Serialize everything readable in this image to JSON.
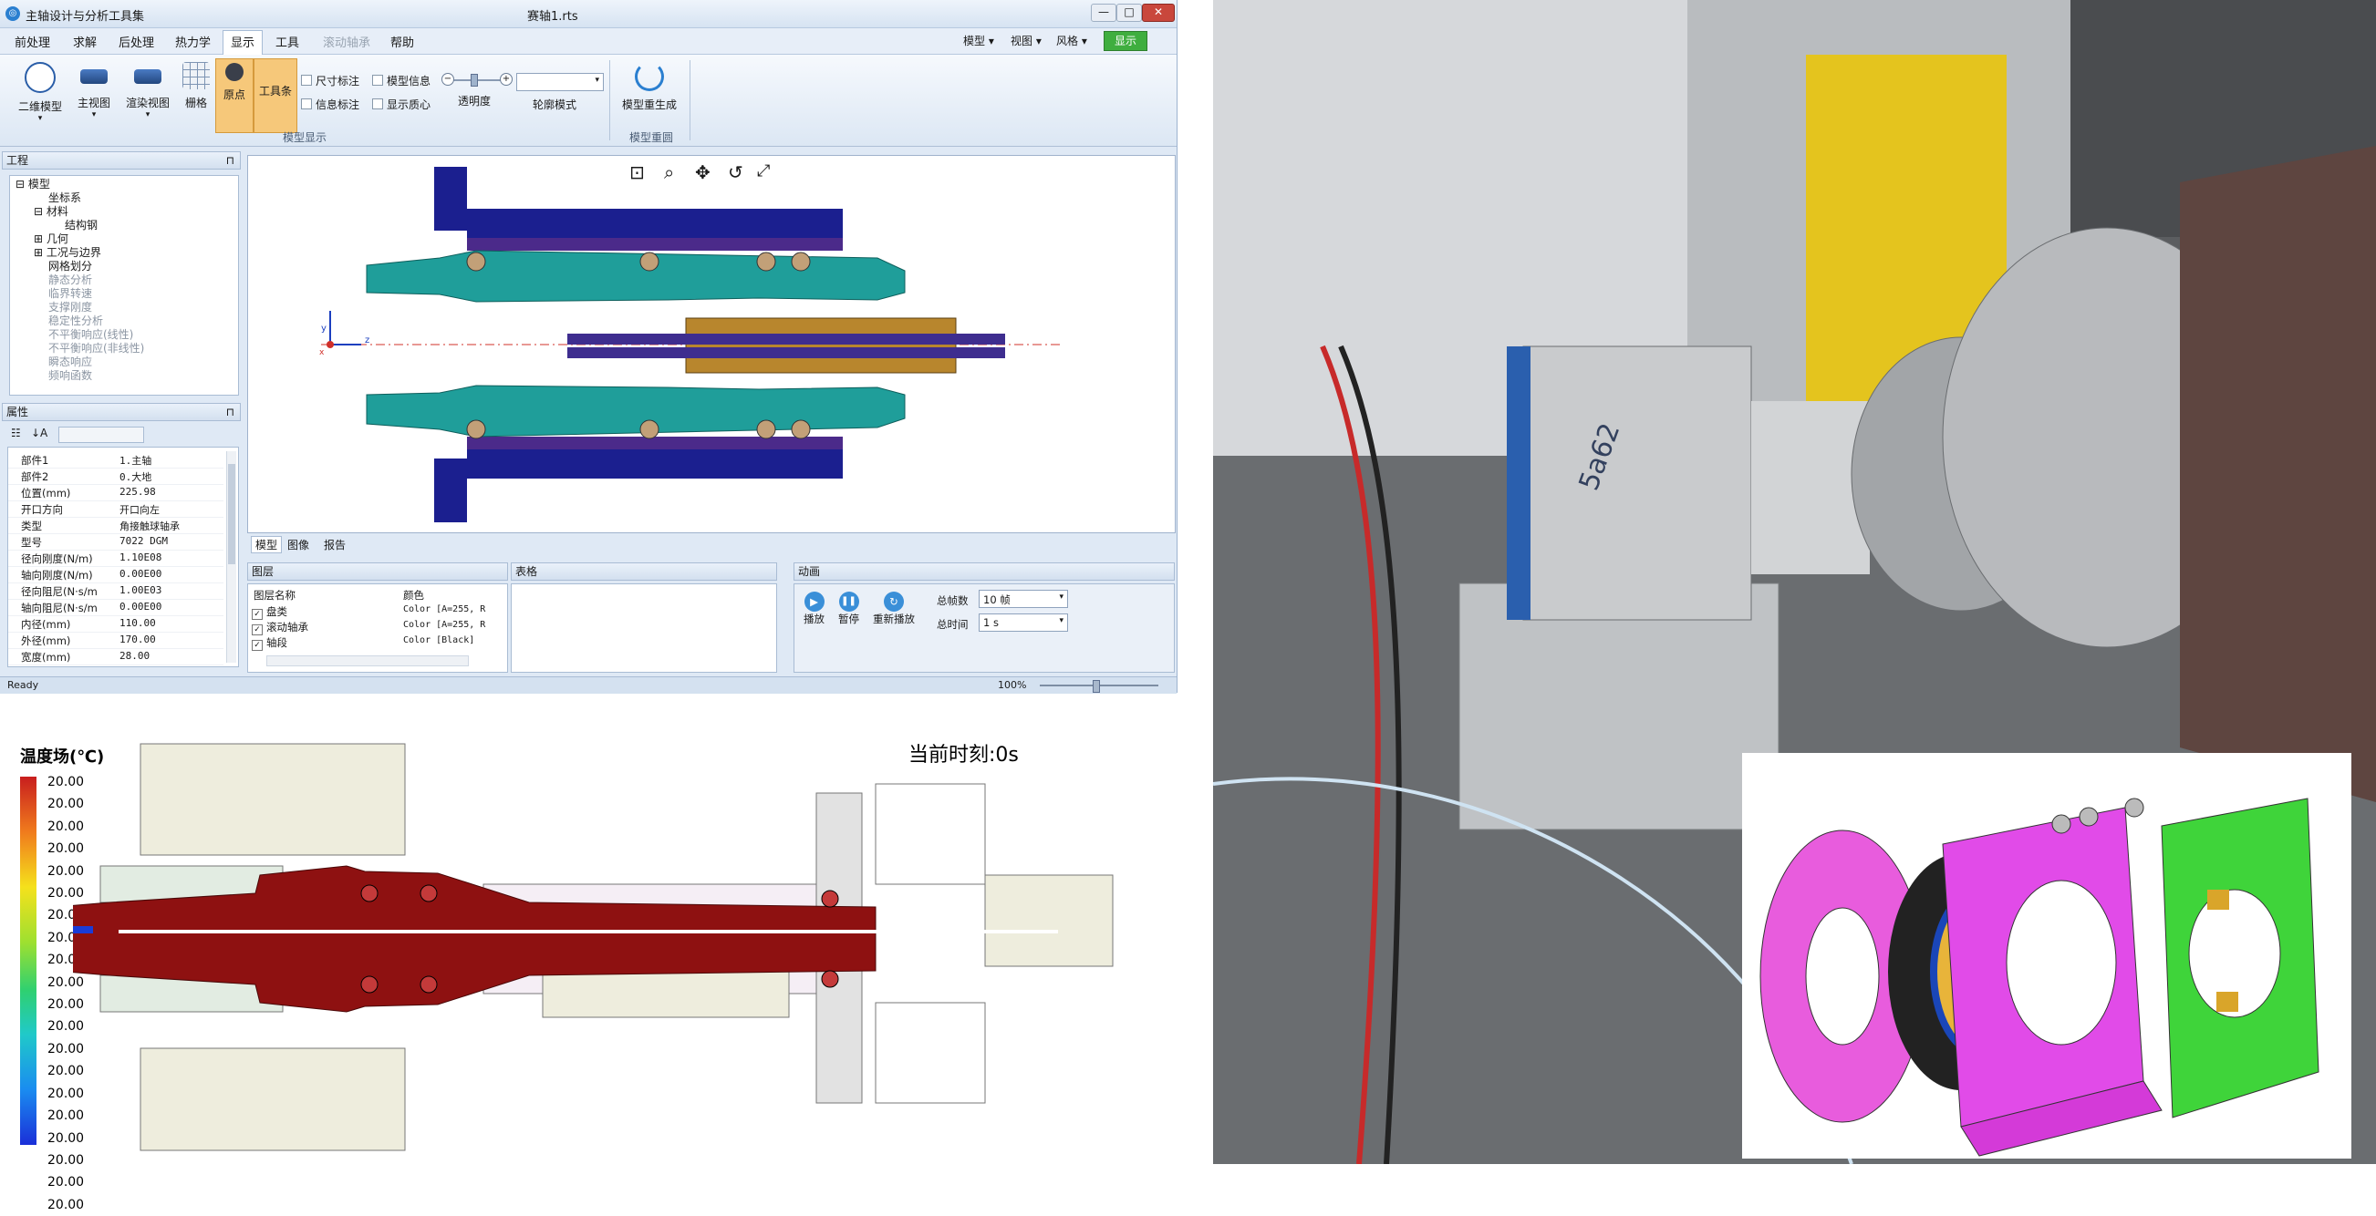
{
  "window": {
    "app_title": "主轴设计与分析工具集",
    "document_title": "赛轴1.rts",
    "min_label": "—",
    "max_label": "□",
    "close_label": "✕"
  },
  "menu": {
    "items": [
      "前处理",
      "求解",
      "后处理",
      "热力学",
      "显示",
      "工具",
      "滚动轴承",
      "帮助"
    ],
    "active": "显示",
    "right": {
      "model": "模型 ▾",
      "view": "视图 ▾",
      "style": "风格 ▾",
      "display": "显示"
    }
  },
  "ribbon": {
    "btn_2d_model": "二维模型",
    "btn_main_view": "主视图",
    "btn_render_view": "渲染视图",
    "btn_grid": "栅格",
    "btn_origin": "原点",
    "btn_toolbar": "工具条",
    "chk_dim": "尺寸标注",
    "chk_info": "信息标注",
    "chk_model_info": "模型信息",
    "chk_centroid": "显示质心",
    "transparency": "透明度",
    "contour_mode": "轮廓模式",
    "btn_regen": "模型重生成",
    "group_display": "模型显示",
    "group_regen": "模型重圆"
  },
  "project_panel": {
    "title": "工程",
    "tree": [
      {
        "label": "模型",
        "dim": false
      },
      {
        "label": "坐标系",
        "dim": false
      },
      {
        "label": "材料",
        "dim": false
      },
      {
        "label": "结构钢",
        "dim": false
      },
      {
        "label": "几何",
        "dim": false
      },
      {
        "label": "工况与边界",
        "dim": false
      },
      {
        "label": "网格划分",
        "dim": false
      },
      {
        "label": "静态分析",
        "dim": true
      },
      {
        "label": "临界转速",
        "dim": true
      },
      {
        "label": "支撑刚度",
        "dim": true
      },
      {
        "label": "稳定性分析",
        "dim": true
      },
      {
        "label": "不平衡响应(线性)",
        "dim": true
      },
      {
        "label": "不平衡响应(非线性)",
        "dim": true
      },
      {
        "label": "瞬态响应",
        "dim": true
      },
      {
        "label": "频响函数",
        "dim": true
      }
    ]
  },
  "properties_panel": {
    "title": "属性",
    "rows": [
      {
        "k": "部件1",
        "v": "1.主轴"
      },
      {
        "k": "部件2",
        "v": "0.大地"
      },
      {
        "k": "位置(mm)",
        "v": "225.98"
      },
      {
        "k": "开口方向",
        "v": "开口向左"
      },
      {
        "k": "类型",
        "v": "角接触球轴承"
      },
      {
        "k": "型号",
        "v": "7022 DGM"
      },
      {
        "k": "径向刚度(N/m)",
        "v": "1.10E08"
      },
      {
        "k": "轴向刚度(N/m)",
        "v": "0.00E00"
      },
      {
        "k": "径向阻尼(N·s/m",
        "v": "1.00E03"
      },
      {
        "k": "轴向阻尼(N·s/m",
        "v": "0.00E00"
      },
      {
        "k": "内径(mm)",
        "v": "110.00"
      },
      {
        "k": "外径(mm)",
        "v": "170.00"
      },
      {
        "k": "宽度(mm)",
        "v": "28.00"
      }
    ]
  },
  "canvas": {
    "axis_x": "z",
    "axis_y": "y",
    "axis_origin": "x"
  },
  "bottom_tabs": [
    "模型",
    "图像",
    "报告"
  ],
  "layers_panel": {
    "title": "图层",
    "col_name": "图层名称",
    "col_color": "颜色",
    "rows": [
      {
        "name": "盘类",
        "color": "Color [A=255, R"
      },
      {
        "name": "滚动轴承",
        "color": "Color [A=255, R"
      },
      {
        "name": "轴段",
        "color": "Color [Black]"
      }
    ]
  },
  "table_panel": {
    "title": "表格"
  },
  "animation_panel": {
    "title": "动画",
    "play": "播放",
    "pause": "暂停",
    "replay": "重新播放",
    "total_frames_label": "总帧数",
    "total_frames_value": "10 帧",
    "total_time_label": "总时间",
    "total_time_value": "1 s"
  },
  "status": {
    "text": "Ready",
    "zoom": "100%"
  },
  "thermal": {
    "legend_title": "温度场(℃)",
    "legend_values": [
      "20.00",
      "20.00",
      "20.00",
      "20.00",
      "20.00",
      "20.00",
      "20.00",
      "20.00",
      "20.00",
      "20.00",
      "20.00",
      "20.00",
      "20.00",
      "20.00",
      "20.00",
      "20.00",
      "20.00",
      "20.00",
      "20.00",
      "20.00"
    ],
    "current_time": "当前时刻:0s"
  },
  "photo": {
    "label": "5a62"
  },
  "colors": {
    "ribbon_active": "#f6c87a",
    "shaft_teal": "#1f9e9a",
    "housing_blue": "#1b1f8f",
    "thermal_red": "#8e1111",
    "display_green": "#3fae3f"
  }
}
